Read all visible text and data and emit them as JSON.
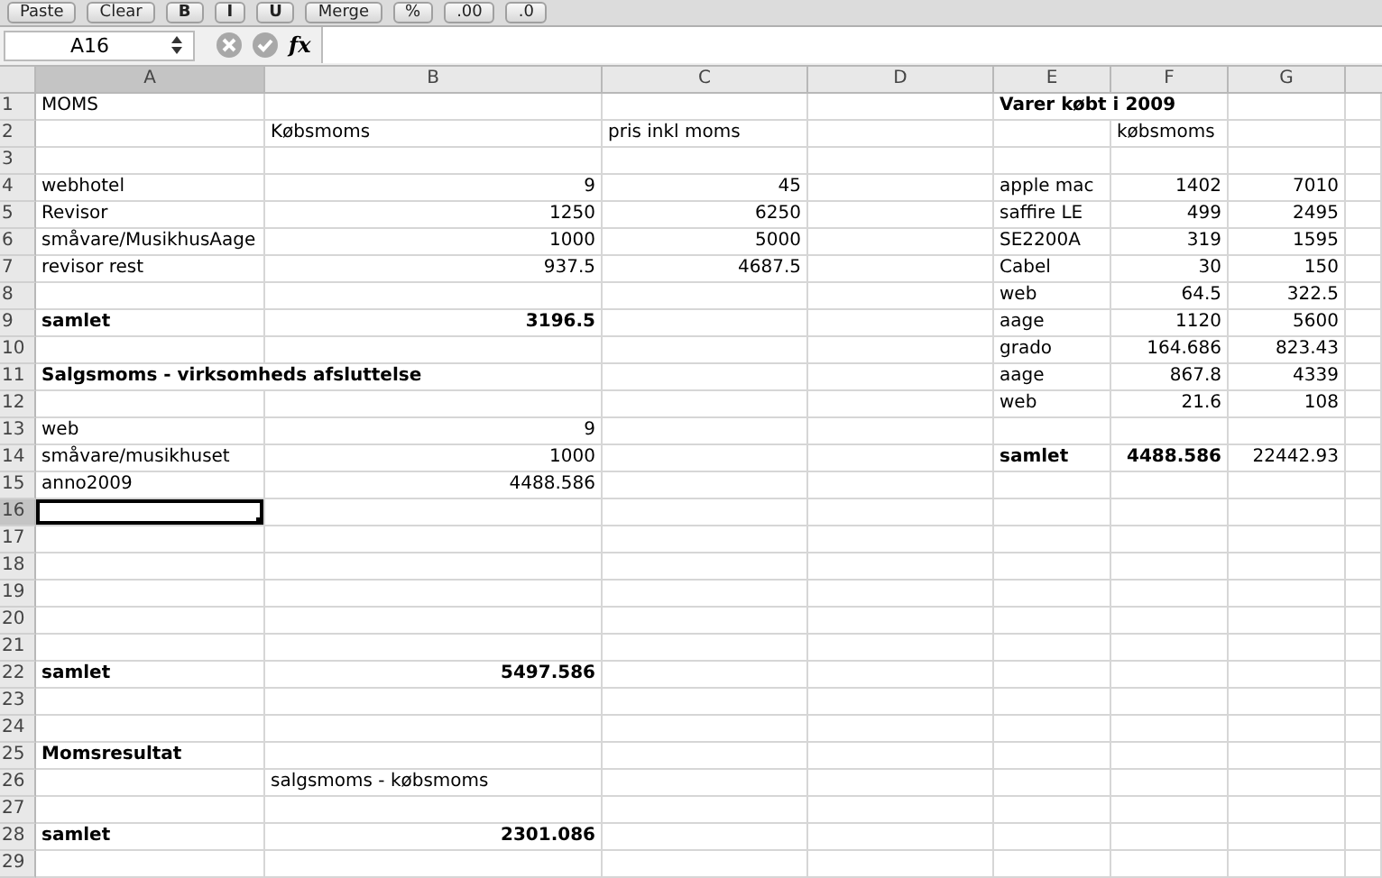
{
  "toolbar": {
    "buttons": [
      {
        "kind": "text",
        "label": "Paste"
      },
      {
        "kind": "text",
        "label": "Clear"
      },
      {
        "kind": "style",
        "label": "B"
      },
      {
        "kind": "style",
        "label": "I"
      },
      {
        "kind": "style",
        "label": "U"
      },
      {
        "kind": "text",
        "label": "Merge"
      },
      {
        "kind": "text",
        "label": "%"
      },
      {
        "kind": "text",
        "label": ".00"
      },
      {
        "kind": "text",
        "label": ".0"
      }
    ]
  },
  "formula_bar": {
    "name_box": "A16",
    "fx": "fx"
  },
  "columns": [
    {
      "label": "A",
      "selected": true
    },
    {
      "label": "B",
      "selected": false
    },
    {
      "label": "C",
      "selected": false
    },
    {
      "label": "D",
      "selected": false
    },
    {
      "label": "E",
      "selected": false
    },
    {
      "label": "F",
      "selected": false
    },
    {
      "label": "G",
      "selected": false
    }
  ],
  "rows": [
    {
      "number": "1",
      "selected": false,
      "cells": {
        "A": {
          "text": "MOMS",
          "bold": false,
          "kind": "text"
        },
        "E": {
          "text": "Varer købt i 2009",
          "bold": true,
          "kind": "text"
        }
      }
    },
    {
      "number": "2",
      "selected": false,
      "cells": {
        "B": {
          "text": "Købsmoms",
          "bold": false,
          "kind": "text"
        },
        "C": {
          "text": "pris inkl moms",
          "bold": false,
          "kind": "text"
        },
        "F": {
          "text": "købsmoms",
          "bold": false,
          "kind": "text"
        }
      }
    },
    {
      "number": "3",
      "selected": false,
      "cells": {}
    },
    {
      "number": "4",
      "selected": false,
      "cells": {
        "A": {
          "text": "webhotel",
          "bold": false,
          "kind": "text"
        },
        "B": {
          "text": "9",
          "bold": false,
          "kind": "number"
        },
        "C": {
          "text": "45",
          "bold": false,
          "kind": "number"
        },
        "E": {
          "text": "apple mac",
          "bold": false,
          "kind": "text"
        },
        "F": {
          "text": "1402",
          "bold": false,
          "kind": "number"
        },
        "G": {
          "text": "7010",
          "bold": false,
          "kind": "number"
        }
      }
    },
    {
      "number": "5",
      "selected": false,
      "cells": {
        "A": {
          "text": "Revisor",
          "bold": false,
          "kind": "text"
        },
        "B": {
          "text": "1250",
          "bold": false,
          "kind": "number"
        },
        "C": {
          "text": "6250",
          "bold": false,
          "kind": "number"
        },
        "E": {
          "text": "saffire LE",
          "bold": false,
          "kind": "text"
        },
        "F": {
          "text": "499",
          "bold": false,
          "kind": "number"
        },
        "G": {
          "text": "2495",
          "bold": false,
          "kind": "number"
        }
      }
    },
    {
      "number": "6",
      "selected": false,
      "cells": {
        "A": {
          "text": "småvare/MusikhusAage",
          "bold": false,
          "kind": "text"
        },
        "B": {
          "text": "1000",
          "bold": false,
          "kind": "number"
        },
        "C": {
          "text": "5000",
          "bold": false,
          "kind": "number"
        },
        "E": {
          "text": "SE2200A",
          "bold": false,
          "kind": "text"
        },
        "F": {
          "text": "319",
          "bold": false,
          "kind": "number"
        },
        "G": {
          "text": "1595",
          "bold": false,
          "kind": "number"
        }
      }
    },
    {
      "number": "7",
      "selected": false,
      "cells": {
        "A": {
          "text": "revisor rest",
          "bold": false,
          "kind": "text"
        },
        "B": {
          "text": "937.5",
          "bold": false,
          "kind": "number"
        },
        "C": {
          "text": "4687.5",
          "bold": false,
          "kind": "number"
        },
        "E": {
          "text": "Cabel",
          "bold": false,
          "kind": "text"
        },
        "F": {
          "text": "30",
          "bold": false,
          "kind": "number"
        },
        "G": {
          "text": "150",
          "bold": false,
          "kind": "number"
        }
      }
    },
    {
      "number": "8",
      "selected": false,
      "cells": {
        "E": {
          "text": "web",
          "bold": false,
          "kind": "text"
        },
        "F": {
          "text": "64.5",
          "bold": false,
          "kind": "number"
        },
        "G": {
          "text": "322.5",
          "bold": false,
          "kind": "number"
        }
      }
    },
    {
      "number": "9",
      "selected": false,
      "cells": {
        "A": {
          "text": "samlet",
          "bold": true,
          "kind": "text"
        },
        "B": {
          "text": "3196.5",
          "bold": true,
          "kind": "number"
        },
        "E": {
          "text": "aage",
          "bold": false,
          "kind": "text"
        },
        "F": {
          "text": "1120",
          "bold": false,
          "kind": "number"
        },
        "G": {
          "text": "5600",
          "bold": false,
          "kind": "number"
        }
      }
    },
    {
      "number": "10",
      "selected": false,
      "cells": {
        "E": {
          "text": "grado",
          "bold": false,
          "kind": "text"
        },
        "F": {
          "text": "164.686",
          "bold": false,
          "kind": "number"
        },
        "G": {
          "text": "823.43",
          "bold": false,
          "kind": "number"
        }
      }
    },
    {
      "number": "11",
      "selected": false,
      "cells": {
        "A": {
          "text": "Salgsmoms - virksomheds afsluttelse",
          "bold": true,
          "kind": "text"
        },
        "E": {
          "text": "aage",
          "bold": false,
          "kind": "text"
        },
        "F": {
          "text": "867.8",
          "bold": false,
          "kind": "number"
        },
        "G": {
          "text": "4339",
          "bold": false,
          "kind": "number"
        }
      }
    },
    {
      "number": "12",
      "selected": false,
      "cells": {
        "E": {
          "text": "web",
          "bold": false,
          "kind": "text"
        },
        "F": {
          "text": "21.6",
          "bold": false,
          "kind": "number"
        },
        "G": {
          "text": "108",
          "bold": false,
          "kind": "number"
        }
      }
    },
    {
      "number": "13",
      "selected": false,
      "cells": {
        "A": {
          "text": "web",
          "bold": false,
          "kind": "text"
        },
        "B": {
          "text": "9",
          "bold": false,
          "kind": "number"
        }
      }
    },
    {
      "number": "14",
      "selected": false,
      "cells": {
        "A": {
          "text": "småvare/musikhuset",
          "bold": false,
          "kind": "text"
        },
        "B": {
          "text": "1000",
          "bold": false,
          "kind": "number"
        },
        "E": {
          "text": "samlet",
          "bold": true,
          "kind": "text"
        },
        "F": {
          "text": "4488.586",
          "bold": true,
          "kind": "number"
        },
        "G": {
          "text": "22442.93",
          "bold": false,
          "kind": "number"
        }
      }
    },
    {
      "number": "15",
      "selected": false,
      "cells": {
        "A": {
          "text": "anno2009",
          "bold": false,
          "kind": "text"
        },
        "B": {
          "text": "4488.586",
          "bold": false,
          "kind": "number"
        }
      }
    },
    {
      "number": "16",
      "selected": true,
      "cells": {}
    },
    {
      "number": "17",
      "selected": false,
      "cells": {}
    },
    {
      "number": "18",
      "selected": false,
      "cells": {}
    },
    {
      "number": "19",
      "selected": false,
      "cells": {}
    },
    {
      "number": "20",
      "selected": false,
      "cells": {}
    },
    {
      "number": "21",
      "selected": false,
      "cells": {}
    },
    {
      "number": "22",
      "selected": false,
      "cells": {
        "A": {
          "text": "samlet",
          "bold": true,
          "kind": "text"
        },
        "B": {
          "text": "5497.586",
          "bold": true,
          "kind": "number"
        }
      }
    },
    {
      "number": "23",
      "selected": false,
      "cells": {}
    },
    {
      "number": "24",
      "selected": false,
      "cells": {}
    },
    {
      "number": "25",
      "selected": false,
      "cells": {
        "A": {
          "text": "Momsresultat",
          "bold": true,
          "kind": "text"
        }
      }
    },
    {
      "number": "26",
      "selected": false,
      "cells": {
        "B": {
          "text": "salgsmoms - købsmoms",
          "bold": false,
          "kind": "text"
        }
      }
    },
    {
      "number": "27",
      "selected": false,
      "cells": {}
    },
    {
      "number": "28",
      "selected": false,
      "cells": {
        "A": {
          "text": "samlet",
          "bold": true,
          "kind": "text"
        },
        "B": {
          "text": "2301.086",
          "bold": true,
          "kind": "number"
        }
      }
    },
    {
      "number": "29",
      "selected": false,
      "cells": {}
    }
  ]
}
